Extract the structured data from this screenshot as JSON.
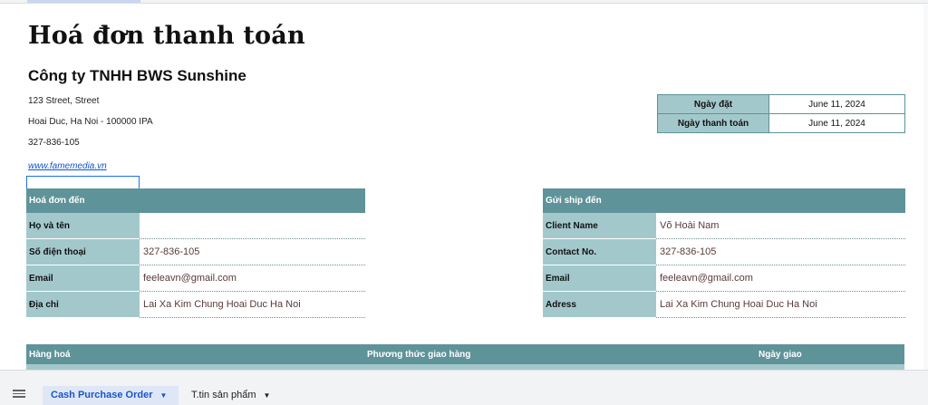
{
  "invoice": {
    "title": "Hoá đơn thanh toán",
    "company": "Công ty TNHH BWS Sunshine",
    "address_line1": "123 Street, Street",
    "address_line2": "Hoai Duc, Ha Noi - 100000 IPA",
    "phone": "327-836-105",
    "website": "www.famemedia.vn"
  },
  "dates": {
    "order_label": "Ngày đặt",
    "order_value": "June 11, 2024",
    "payment_label": "Ngày thanh toán",
    "payment_value": "June 11, 2024"
  },
  "bill_to": {
    "header": "Hoá đơn đến",
    "rows": [
      {
        "label": "Họ và tên",
        "value": ""
      },
      {
        "label": "Số điện thoại",
        "value": "327-836-105"
      },
      {
        "label": "Email",
        "value": "feeleavn@gmail.com"
      },
      {
        "label": "Địa chỉ",
        "value": "Lai Xa Kim Chung Hoai Duc Ha Noi"
      }
    ]
  },
  "ship_to": {
    "header": "Gửi ship đến",
    "rows": [
      {
        "label": "Client Name",
        "value": "Võ Hoài Nam"
      },
      {
        "label": "Contact No.",
        "value": "327-836-105"
      },
      {
        "label": "Email",
        "value": "feeleavn@gmail.com"
      },
      {
        "label": "Adress",
        "value": "Lai Xa Kim Chung Hoai Duc Ha Noi"
      }
    ]
  },
  "goods_header": {
    "col1": "Hàng hoá",
    "col2": "Phương thức giao hàng",
    "col3": "Ngày giao"
  },
  "sheet_tabs": [
    {
      "label": "Cash Purchase Order",
      "active": true
    },
    {
      "label": "T.tin sản phẩm",
      "active": false
    }
  ],
  "icons": {
    "menu": "menu-icon",
    "tab_dropdown": "caret-down-icon"
  },
  "colors": {
    "header_teal": "#5e9399",
    "label_teal_light": "#a3c8cc",
    "link_blue": "#1155cc",
    "active_tab": "#1a56c8"
  }
}
